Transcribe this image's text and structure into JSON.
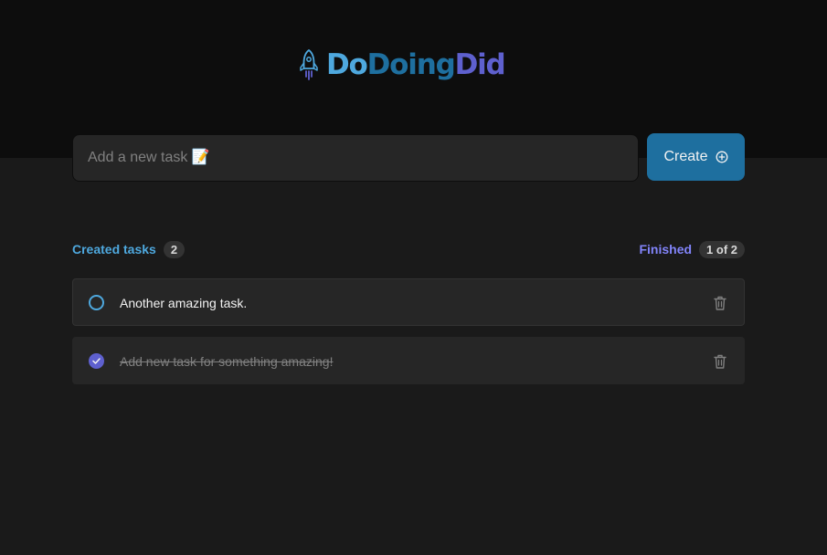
{
  "app": {
    "logo_part1": "Do",
    "logo_part2": "Doing",
    "logo_part3": "Did",
    "rocket_icon": "rocket-icon"
  },
  "new_task": {
    "placeholder": "Add a new task 📝",
    "value": "",
    "create_label": "Create",
    "create_icon": "plus-circle-icon"
  },
  "counters": {
    "created_label": "Created tasks",
    "created_count": "2",
    "finished_label": "Finished",
    "finished_count": "1 of 2"
  },
  "tasks": [
    {
      "text": "Another amazing task.",
      "done": false
    },
    {
      "text": "Add new task for something amazing!",
      "done": true
    }
  ],
  "colors": {
    "header_bg": "#0d0d0d",
    "page_bg": "#1a1a1a",
    "blue": "#4ea8de",
    "blue_dark": "#1e6f9f",
    "purple": "#5e60ce",
    "purple_light": "#8284fa",
    "card_bg": "#262626",
    "muted_text": "#808080"
  }
}
